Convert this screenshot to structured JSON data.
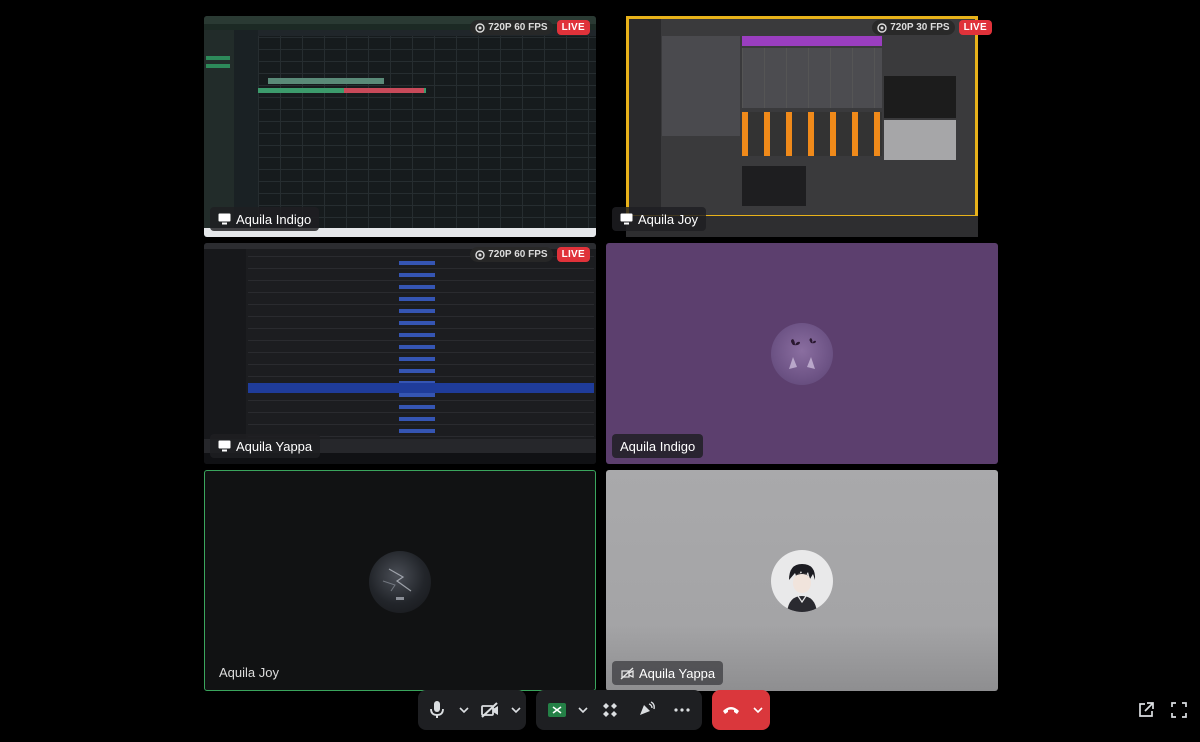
{
  "tiles": [
    {
      "label": "Aquila Indigo",
      "quality": "720P 60 FPS",
      "live": "LIVE"
    },
    {
      "label": "Aquila Joy",
      "quality": "720P 30 FPS",
      "live": "LIVE"
    },
    {
      "label": "Aquila Yappa",
      "quality": "720P 60 FPS",
      "live": "LIVE"
    },
    {
      "label": "Aquila Indigo"
    },
    {
      "label": "Aquila Joy"
    },
    {
      "label": "Aquila Yappa"
    }
  ],
  "colors": {
    "background": "#000000",
    "purple_tile": "#5c3f6e",
    "grey_tile": "#a7a7a9",
    "dark_tile": "#111213",
    "speaking_border": "#3aa55d",
    "live_red": "#e0323a",
    "end_call_red": "#da373c",
    "share_green": "#248046"
  },
  "controls": {
    "icons": [
      "microphone-icon",
      "camera-off-icon",
      "screen-share-icon",
      "activities-icon",
      "soundboard-icon",
      "more-icon",
      "hang-up-icon",
      "popout-icon",
      "fullscreen-icon"
    ]
  }
}
